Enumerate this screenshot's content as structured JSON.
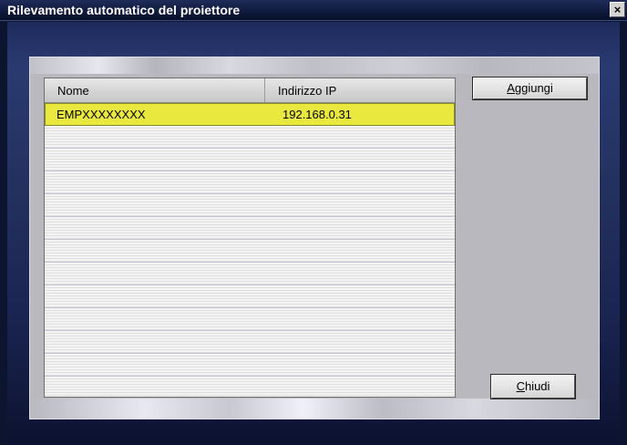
{
  "window": {
    "title": "Rilevamento automatico del proiettore",
    "close_glyph": "×"
  },
  "list": {
    "columns": [
      "Nome",
      "Indirizzo IP"
    ],
    "rows": [
      {
        "name": "EMPXXXXXXXX",
        "ip": "192.168.0.31",
        "selected": true
      }
    ],
    "empty_row_count": 12
  },
  "buttons": {
    "add_mnemonic": "A",
    "add_rest": "ggiungi",
    "close_mnemonic": "C",
    "close_rest": "hiudi"
  },
  "colors": {
    "selection": "#e8e83e",
    "panel": "#b8b8be",
    "window_bg": "#0d1430"
  }
}
